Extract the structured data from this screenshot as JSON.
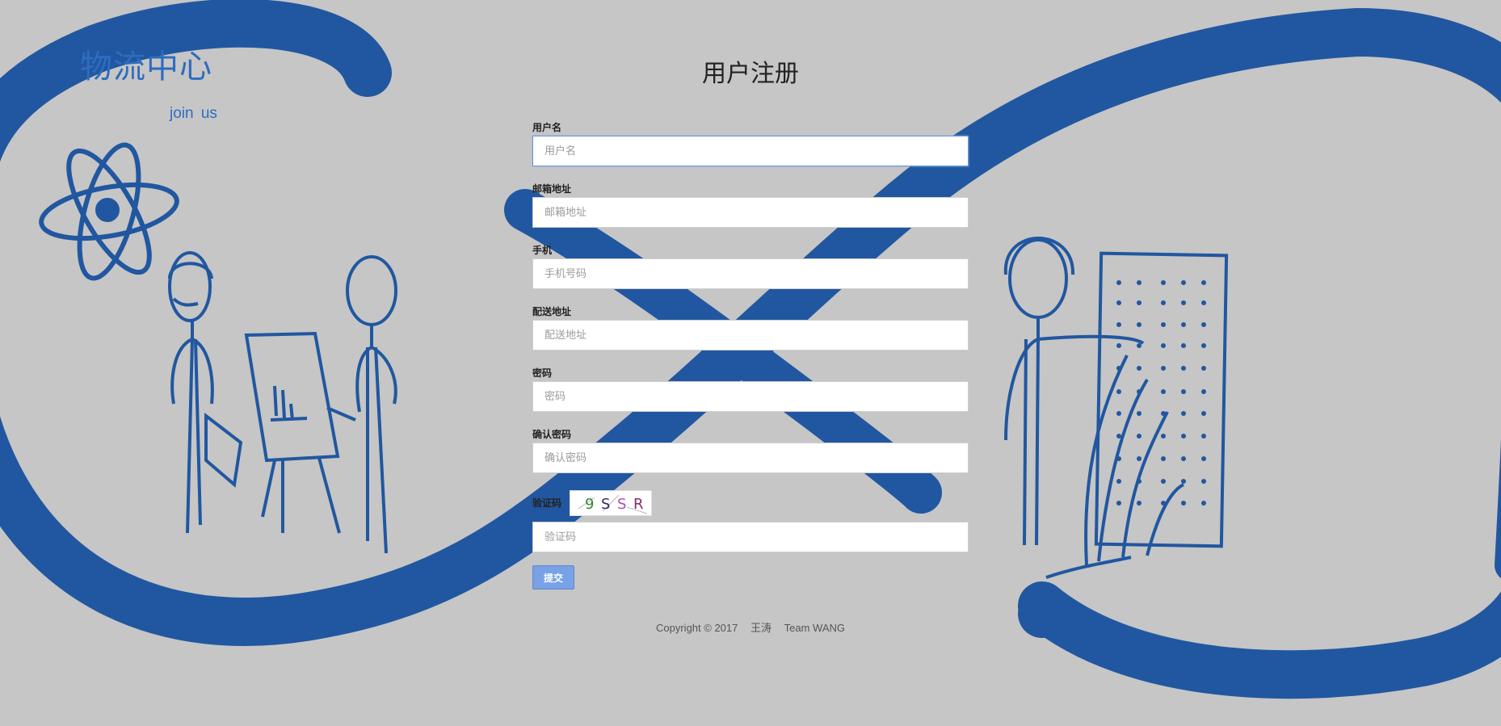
{
  "brand": {
    "title": "物流中心",
    "subtitle": "join  us"
  },
  "page": {
    "title": "用户注册"
  },
  "form": {
    "username": {
      "label": "用户名",
      "placeholder": "用户名",
      "value": ""
    },
    "email": {
      "label": "邮箱地址",
      "placeholder": "邮箱地址",
      "value": ""
    },
    "phone": {
      "label": "手机",
      "placeholder": "手机号码",
      "value": ""
    },
    "address": {
      "label": "配送地址",
      "placeholder": "配送地址",
      "value": ""
    },
    "password": {
      "label": "密码",
      "placeholder": "密码",
      "value": ""
    },
    "confirm_password": {
      "label": "确认密码",
      "placeholder": "确认密码",
      "value": ""
    },
    "captcha": {
      "label": "验证码",
      "placeholder": "验证码",
      "value": "",
      "image_text": [
        "9",
        "S",
        "S",
        "R"
      ],
      "image_colors": [
        "#2f8a3a",
        "#2b2b6b",
        "#b04ab8",
        "#8a2a6a"
      ]
    },
    "submit_label": "提交"
  },
  "footer": {
    "copyright": "Copyright © 2017",
    "author": "王涛",
    "team": "Team WANG"
  },
  "colors": {
    "background": "#c6c6c6",
    "brand_blue": "#2d6cc0",
    "stroke_blue": "#2157a0",
    "button": "#79a1e6"
  }
}
